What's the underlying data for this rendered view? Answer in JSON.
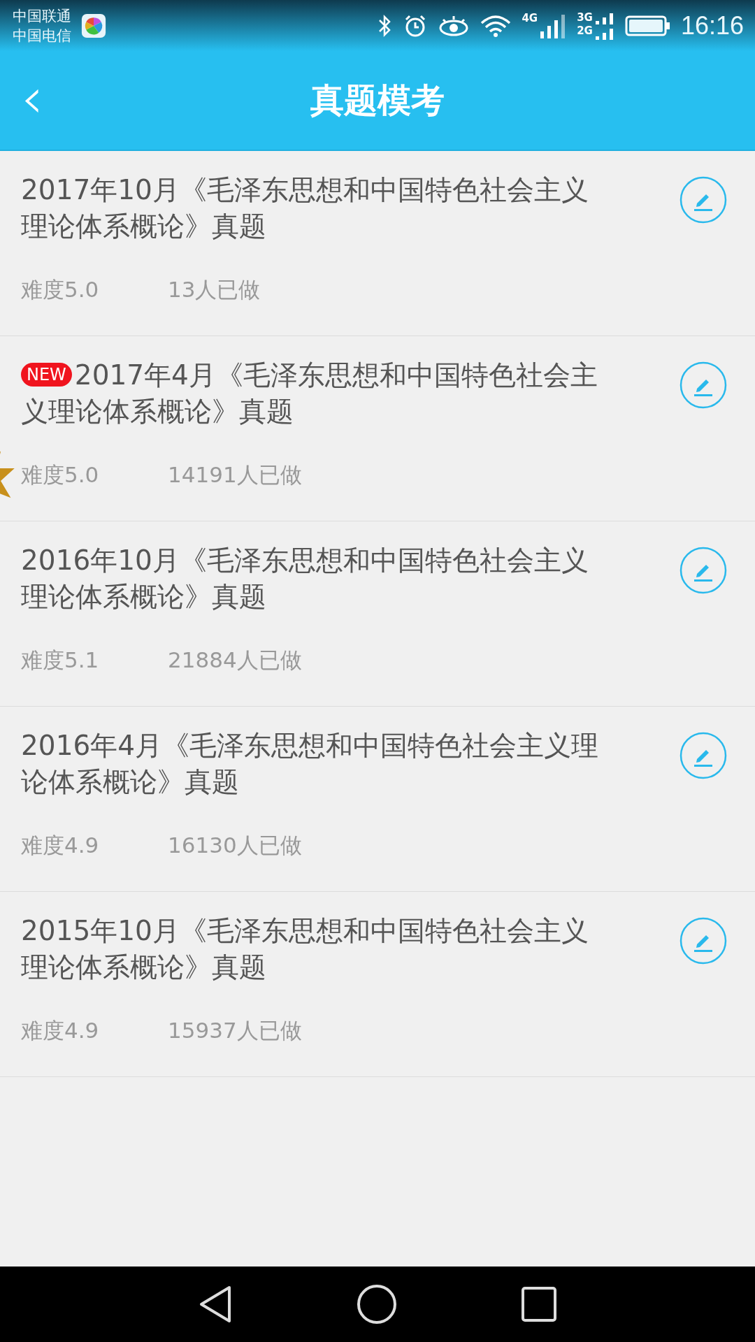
{
  "status_bar": {
    "carriers": [
      "中国联通",
      "中国电信"
    ],
    "network_1": "4G",
    "network_2a": "3G",
    "network_2b": "2G",
    "time": "16:16"
  },
  "header": {
    "back": "‹",
    "title": "真题模考"
  },
  "items": [
    {
      "title": "2017年10月《毛泽东思想和中国特色社会主义理论体系概论》真题",
      "new": false,
      "difficulty": "难度5.0",
      "count": "13人已做"
    },
    {
      "title": "2017年4月《毛泽东思想和中国特色社会主义理论体系概论》真题",
      "new": true,
      "badge": "NEW",
      "difficulty": "难度5.0",
      "count": "14191人已做"
    },
    {
      "title": "2016年10月《毛泽东思想和中国特色社会主义理论体系概论》真题",
      "new": false,
      "difficulty": "难度5.1",
      "count": "21884人已做"
    },
    {
      "title": "2016年4月《毛泽东思想和中国特色社会主义理论体系概论》真题",
      "new": false,
      "difficulty": "难度4.9",
      "count": "16130人已做"
    },
    {
      "title": "2015年10月《毛泽东思想和中国特色社会主义理论体系概论》真题",
      "new": false,
      "difficulty": "难度4.9",
      "count": "15937人已做"
    }
  ]
}
